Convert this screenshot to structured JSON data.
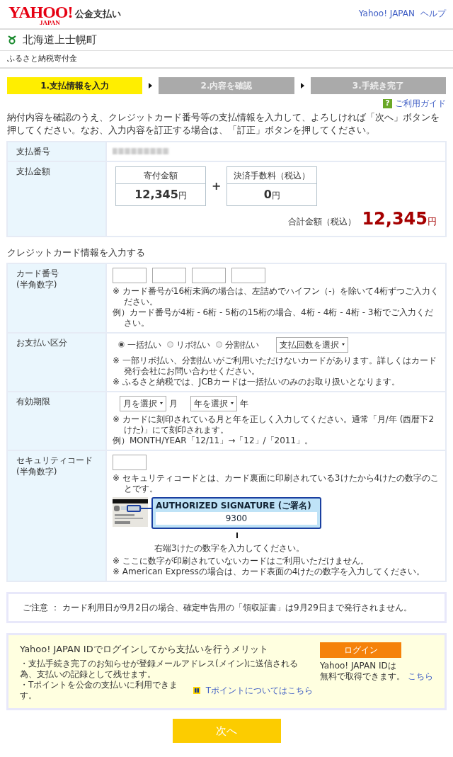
{
  "header": {
    "logo_main": "YAHOO!",
    "logo_sub": "JAPAN",
    "service": "公金支払い",
    "links": [
      "Yahoo! JAPAN",
      "ヘルプ"
    ]
  },
  "municipality": {
    "name": "北海道上士幌町",
    "subtitle": "ふるさと納税寄付金"
  },
  "steps": [
    {
      "label": "1.支払情報を入力",
      "selected": true
    },
    {
      "label": "2.内容を確認",
      "selected": false
    },
    {
      "label": "3.手続き完了",
      "selected": false
    }
  ],
  "guide": {
    "icon": "?",
    "label": "ご利用ガイド"
  },
  "intro": "納付内容を確認のうえ、クレジットカード番号等の支払情報を入力して、よろしければ「次へ」ボタンを押してください。なお、入力内容を訂正する場合は、「訂正」ボタンを押してください。",
  "payment": {
    "number_label": "支払番号",
    "amount_label": "支払金額",
    "donation": {
      "label": "寄付金額",
      "value": "12,345",
      "unit": "円"
    },
    "plus": "+",
    "fee": {
      "label": "決済手数料（税込）",
      "value": "0",
      "unit": "円"
    },
    "total_label": "合計金額（税込）",
    "total_value": "12,345",
    "total_unit": "円"
  },
  "card_section_title": "クレジットカード情報を入力する",
  "card_number": {
    "label": "カード番号",
    "sublabel": "(半角数字)",
    "notes": [
      "※ カード番号が16桁未満の場合は、左詰めでハイフン（-）を除いて4桁ずつご入力ください。",
      "例）カード番号が4桁 - 6桁 - 5桁の15桁の場合、4桁 - 4桁 - 4桁 - 3桁でご入力ください。"
    ]
  },
  "payment_type": {
    "label": "お支払い区分",
    "options": [
      {
        "label": "一括払い",
        "selected": true
      },
      {
        "label": "リボ払い",
        "selected": false
      },
      {
        "label": "分割払い",
        "selected": false
      }
    ],
    "select": "支払回数を選択",
    "notes": [
      "※ 一部リボ払い、分割払いがご利用いただけないカードがあります。詳しくはカード発行会社にお問い合わせください。",
      "※ ふるさと納税では、JCBカードは一括払いのみのお取り扱いとなります。"
    ]
  },
  "expiry": {
    "label": "有効期限",
    "month_select": "月を選択",
    "month_unit": "月",
    "year_select": "年を選択",
    "year_unit": "年",
    "notes": [
      "※ カードに刻印されている月と年を正しく入力してください。通常「月/年 (西暦下2けた)」にて刻印されます。",
      "例）MONTH/YEAR「12/11」→「12」/「2011」。"
    ]
  },
  "security": {
    "label": "セキュリティコード",
    "sublabel": "(半角数字)",
    "note_before": "※ セキュリティコードとは、カード裏面に印刷されている3けたから4けたの数字のことです。",
    "diagram": {
      "heading": "AUTHORIZED SIGNATURE (ご署名)",
      "number": "9300",
      "caption": "右端3けたの数字を入力してください。"
    },
    "notes_after": [
      "※ ここに数字が印刷されていないカードはご利用いただけません。",
      "※ American Expressの場合は、カード表面の4けたの数字を入力してください。"
    ]
  },
  "notice": "ご注意 ： カード利用日が9月2日の場合、確定申告用の「領収証書」は9月29日まで発行されません。",
  "login_box": {
    "title": "Yahoo! JAPAN IDでログインしてから支払いを行うメリット",
    "bullets": [
      "・支払手続き完了のお知らせが登録メールアドレス(メイン)に送信される為、支払いの記録として残せます。",
      "・Tポイントを公金の支払いに利用できます。"
    ],
    "tpoint_link": "Tポイントについてはこちら",
    "button": "ログイン",
    "aside_line1": "Yahoo! JAPAN IDは",
    "aside_line2": "無料で取得できます。",
    "aside_link": "こちら"
  },
  "next_button": "次へ"
}
